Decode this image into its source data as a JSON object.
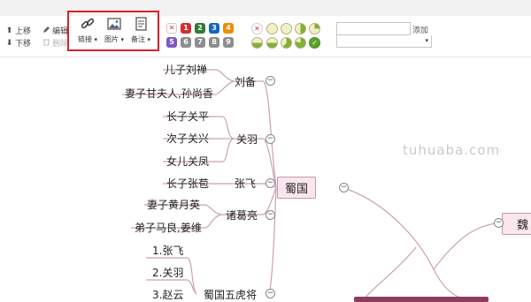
{
  "toolbar": {
    "move_up": "上移",
    "move_down": "下移",
    "edit": "编辑",
    "delete": "删除",
    "link": "链接",
    "image": "图片",
    "note": "备注",
    "add": "添加"
  },
  "priority_labels": [
    "1",
    "2",
    "3",
    "4",
    "5",
    "6",
    "7",
    "8",
    "9"
  ],
  "tree": {
    "central": "蜀国",
    "right_topic": "魏",
    "branches": {
      "liubei": "刘备",
      "guanyu": "关羽",
      "zhangfei": "张飞",
      "zhugeliang": "诸葛亮",
      "wuhu": "蜀国五虎将"
    },
    "leaves": {
      "liubei_son": "儿子刘禅",
      "liubei_wife": "妻子甘夫人,孙尚香",
      "guanyu_son1": "长子关平",
      "guanyu_son2": "次子关兴",
      "guanyu_daughter": "女儿关凤",
      "zhangfei_son": "长子张苞",
      "zhuge_wife": "妻子黄月英",
      "zhuge_students": "弟子马良,姜维",
      "wuhu_1": "1.张飞",
      "wuhu_2": "2.关羽",
      "wuhu_3": "3.赵云"
    }
  },
  "watermark": "tuhuaba.com",
  "colors": {
    "highlight_border": "#d8222a",
    "branch_line": "#c9a1b8",
    "root_fill": "#f9e7ee"
  }
}
